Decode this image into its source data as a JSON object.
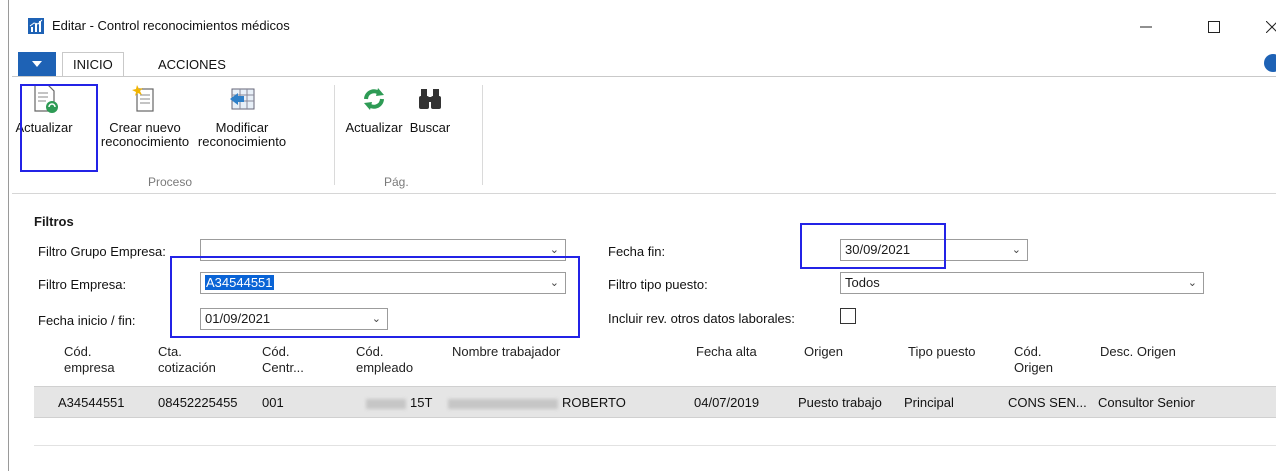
{
  "window": {
    "title": "Editar - Control reconocimientos médicos"
  },
  "ribbon_tabs": {
    "inicio": "INICIO",
    "acciones": "ACCIONES"
  },
  "ribbon": {
    "actualizar": "Actualizar",
    "crear_line1": "Crear nuevo",
    "crear_line2": "reconocimiento",
    "modificar_line1": "Modificar",
    "modificar_line2": "reconocimiento",
    "actualizar_pag": "Actualizar",
    "buscar": "Buscar",
    "group_proceso": "Proceso",
    "group_pag": "Pág."
  },
  "filters": {
    "title": "Filtros",
    "grupo_empresa_label": "Filtro Grupo Empresa:",
    "grupo_empresa_value": "",
    "empresa_label": "Filtro Empresa:",
    "empresa_value": "A34544551",
    "fecha_inicio_label": "Fecha inicio / fin:",
    "fecha_inicio_value": "01/09/2021",
    "fecha_fin_label": "Fecha fin:",
    "fecha_fin_value": "30/09/2021",
    "tipo_puesto_label": "Filtro tipo puesto:",
    "tipo_puesto_value": "Todos",
    "incluir_label": "Incluir rev. otros datos laborales:",
    "incluir_checked": false
  },
  "table": {
    "headers": [
      {
        "l1": "Cód.",
        "l2": "empresa"
      },
      {
        "l1": "Cta.",
        "l2": "cotización"
      },
      {
        "l1": "Cód.",
        "l2": "Centr..."
      },
      {
        "l1": "Cód.",
        "l2": "empleado"
      },
      {
        "l1": "Nombre trabajador",
        "l2": ""
      },
      {
        "l1": "Fecha alta",
        "l2": ""
      },
      {
        "l1": "Origen",
        "l2": ""
      },
      {
        "l1": "Tipo puesto",
        "l2": ""
      },
      {
        "l1": "Cód.",
        "l2": "Origen"
      },
      {
        "l1": "Desc. Origen",
        "l2": ""
      }
    ],
    "rows": [
      {
        "empresa": "A34544551",
        "cotizacion": "08452225455",
        "centro": "001",
        "empleado": "15T",
        "nombre": "ROBERTO",
        "fecha_alta": "04/07/2019",
        "origen": "Puesto trabajo",
        "tipo_puesto": "Principal",
        "cod_origen": "CONS SEN...",
        "desc_origen": "Consultor Senior"
      }
    ]
  },
  "colors": {
    "accent": "#1e62b5",
    "highlight_box": "#2323e6",
    "selection": "#0a64d6"
  }
}
